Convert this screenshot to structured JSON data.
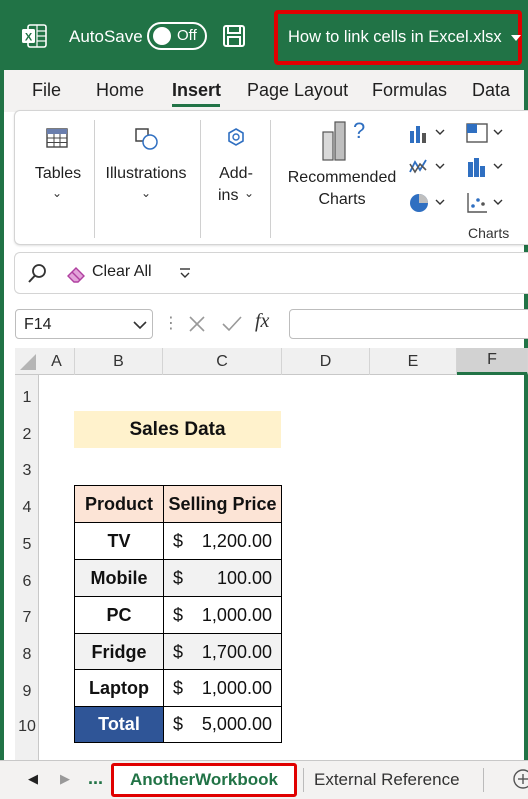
{
  "titlebar": {
    "autosave_label": "AutoSave",
    "autosave_state": "Off",
    "file_title": "How to link cells in Excel.xlsx"
  },
  "menu": {
    "tabs": [
      "File",
      "Home",
      "Insert",
      "Page Layout",
      "Formulas",
      "Data"
    ],
    "active": "Insert"
  },
  "ribbon": {
    "tables": "Tables",
    "illustrations": "Illustrations",
    "addins_line1": "Add-",
    "addins_line2": "ins",
    "recommended_line1": "Recommended",
    "recommended_line2": "Charts",
    "charts_group": "Charts"
  },
  "toolbar2": {
    "clear_all": "Clear All"
  },
  "formula_bar": {
    "name_box": "F14",
    "fx": "fx",
    "formula": ""
  },
  "grid": {
    "columns": [
      "A",
      "B",
      "C",
      "D",
      "E",
      "F"
    ],
    "selected_column": "F",
    "rows": [
      "1",
      "2",
      "3",
      "4",
      "5",
      "6",
      "7",
      "8",
      "9",
      "10"
    ]
  },
  "sheet": {
    "title": "Sales Data",
    "headers": [
      "Product",
      "Selling Price"
    ],
    "products": [
      {
        "name": "TV",
        "currency": "$",
        "amount": "1,200.00"
      },
      {
        "name": "Mobile",
        "currency": "$",
        "amount": "100.00"
      },
      {
        "name": "PC",
        "currency": "$",
        "amount": "1,000.00"
      },
      {
        "name": "Fridge",
        "currency": "$",
        "amount": "1,700.00"
      },
      {
        "name": "Laptop",
        "currency": "$",
        "amount": "1,000.00"
      }
    ],
    "total": {
      "name": "Total",
      "currency": "$",
      "amount": "5,000.00"
    }
  },
  "sheet_tabs": {
    "ellipsis": "...",
    "active": "AnotherWorkbook",
    "other": "External Reference"
  },
  "colors": {
    "excel_green": "#217346",
    "highlight_red": "#e00000",
    "title_fill": "#fff2cc",
    "header_fill": "#fce4d6",
    "total_fill": "#2f5597"
  }
}
